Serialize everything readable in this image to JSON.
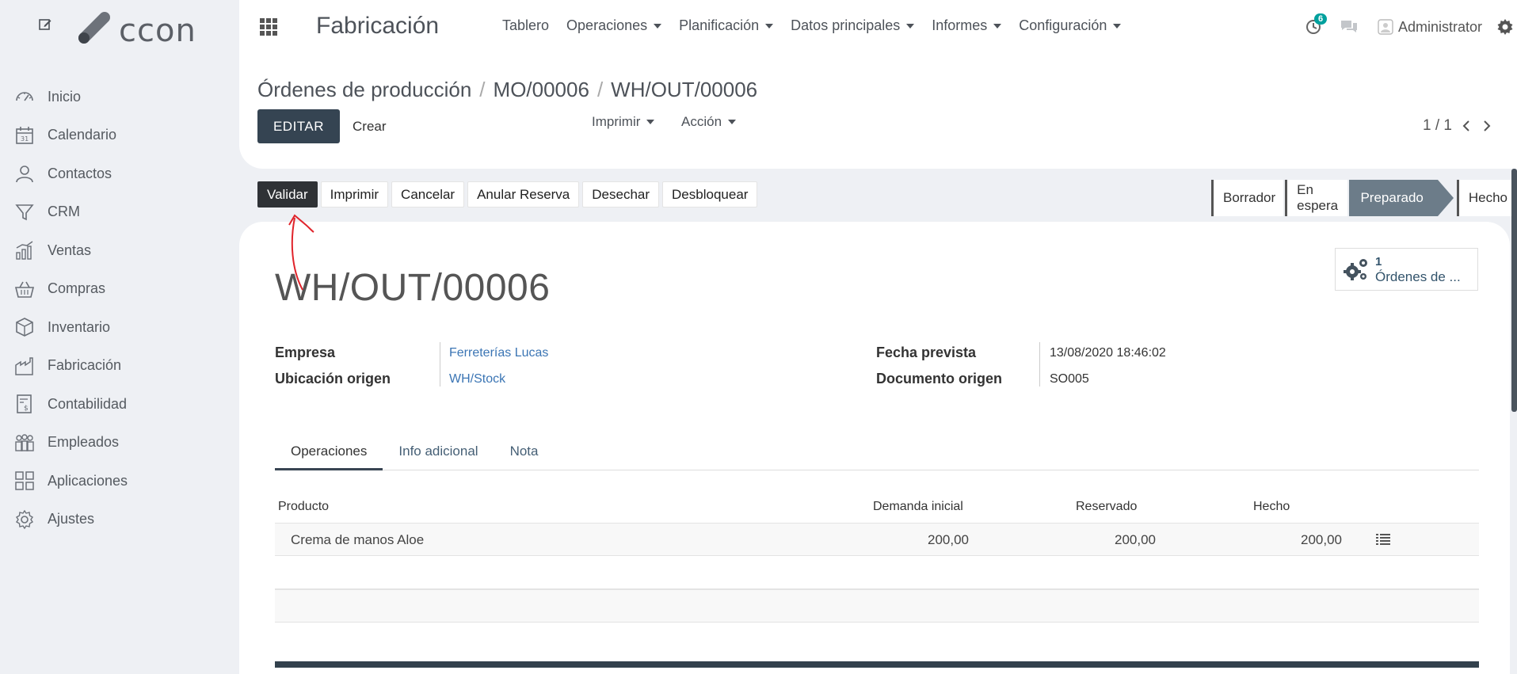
{
  "sidebar": {
    "logo_text": "ccon",
    "items": [
      {
        "label": "Inicio",
        "icon": "dashboard-icon"
      },
      {
        "label": "Calendario",
        "icon": "calendar-icon"
      },
      {
        "label": "Contactos",
        "icon": "contacts-icon"
      },
      {
        "label": "CRM",
        "icon": "funnel-icon"
      },
      {
        "label": "Ventas",
        "icon": "sales-chart-icon"
      },
      {
        "label": "Compras",
        "icon": "basket-icon"
      },
      {
        "label": "Inventario",
        "icon": "box-icon"
      },
      {
        "label": "Fabricación",
        "icon": "factory-icon"
      },
      {
        "label": "Contabilidad",
        "icon": "invoice-icon"
      },
      {
        "label": "Empleados",
        "icon": "employees-icon"
      },
      {
        "label": "Aplicaciones",
        "icon": "apps-icon"
      },
      {
        "label": "Ajustes",
        "icon": "gear-icon"
      }
    ]
  },
  "topbar": {
    "app_title": "Fabricación",
    "nav": [
      {
        "label": "Tablero",
        "has_caret": false
      },
      {
        "label": "Operaciones",
        "has_caret": true
      },
      {
        "label": "Planificación",
        "has_caret": true
      },
      {
        "label": "Datos principales",
        "has_caret": true
      },
      {
        "label": "Informes",
        "has_caret": true
      },
      {
        "label": "Configuración",
        "has_caret": true
      }
    ],
    "activity_count": "6",
    "user": "Administrator"
  },
  "control_panel": {
    "breadcrumb": [
      "Órdenes de producción",
      "MO/00006",
      "WH/OUT/00006"
    ],
    "edit_label": "EDITAR",
    "create_label": "Crear",
    "print_label": "Imprimir",
    "action_label": "Acción",
    "pager": "1 / 1"
  },
  "statusbar": {
    "buttons": [
      "Validar",
      "Imprimir",
      "Cancelar",
      "Anular Reserva",
      "Desechar",
      "Desbloquear"
    ],
    "stages": [
      "Borrador",
      "En espera",
      "Preparado",
      "Hecho"
    ],
    "active_stage": "Preparado"
  },
  "form": {
    "smart_button": {
      "count": "1",
      "label": "Órdenes de ..."
    },
    "title": "WH/OUT/00006",
    "fields": {
      "empresa_label": "Empresa",
      "empresa_value": "Ferreterías Lucas",
      "ubicacion_label": "Ubicación origen",
      "ubicacion_value": "WH/Stock",
      "fecha_label": "Fecha prevista",
      "fecha_value": "13/08/2020 18:46:02",
      "documento_label": "Documento origen",
      "documento_value": "SO005"
    },
    "tabs": [
      "Operaciones",
      "Info adicional",
      "Nota"
    ],
    "table": {
      "headers": [
        "Producto",
        "Demanda inicial",
        "Reservado",
        "Hecho"
      ],
      "rows": [
        {
          "producto": "Crema de manos Aloe",
          "demanda": "200,00",
          "reservado": "200,00",
          "hecho": "200,00"
        }
      ]
    }
  },
  "colors": {
    "dark_button": "#354452",
    "link": "#3b75b4",
    "active_stage": "#6c7c89",
    "badge": "#00a09d",
    "annotation": "#e0242b"
  }
}
